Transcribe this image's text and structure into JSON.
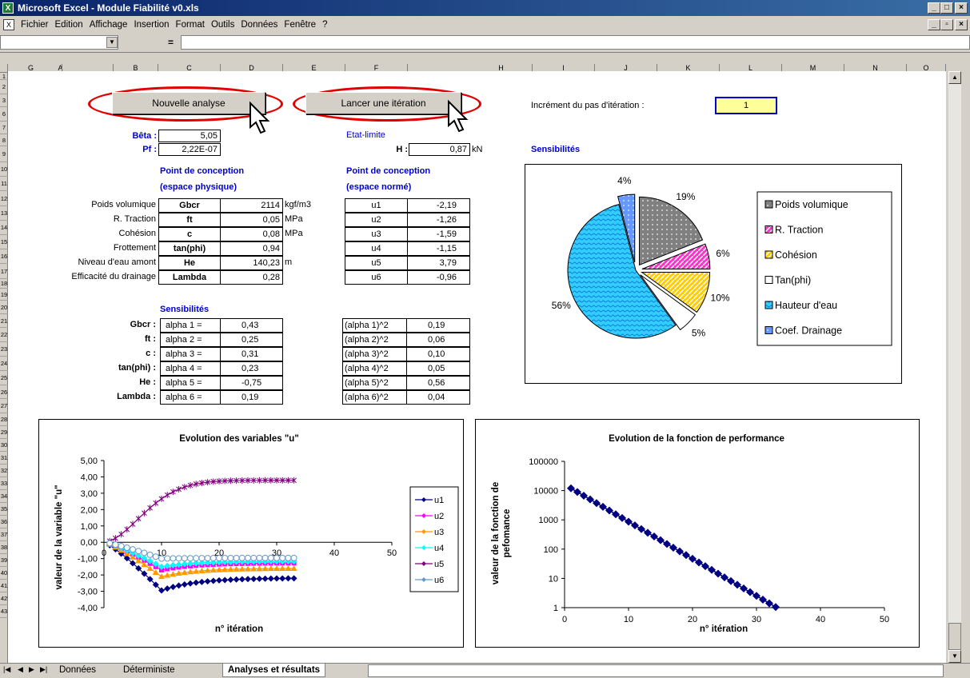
{
  "window": {
    "title": "Microsoft Excel - Module Fiabilité v0.xls",
    "icon": "excel-icon"
  },
  "menu": [
    "Fichier",
    "Edition",
    "Affichage",
    "Insertion",
    "Format",
    "Outils",
    "Données",
    "Fenêtre",
    "?"
  ],
  "formula": {
    "name_box": "",
    "equals": "=",
    "content": ""
  },
  "columns": [
    "A",
    "B",
    "C",
    "D",
    "E",
    "F",
    "G",
    "H",
    "I",
    "J",
    "K",
    "L",
    "M",
    "N",
    "O"
  ],
  "rows": [
    "1",
    "2",
    "3",
    "6",
    "7",
    "8",
    "9",
    "10",
    "11",
    "12",
    "13",
    "14",
    "15",
    "16",
    "17",
    "18",
    "19",
    "20",
    "21",
    "22",
    "23",
    "24",
    "25",
    "26",
    "27",
    "28",
    "29",
    "30",
    "31",
    "32",
    "33",
    "34",
    "35",
    "36",
    "37",
    "38",
    "39",
    "40",
    "41",
    "42",
    "43"
  ],
  "buttons": {
    "new_analysis": "Nouvelle analyse",
    "run_iteration": "Lancer une itération"
  },
  "increment": {
    "label": "Incrément du pas d'itération :",
    "value": "1"
  },
  "beta": {
    "label": "Bêta :",
    "value": "5,05"
  },
  "pf": {
    "label": "Pf :",
    "value": "2,22E-07"
  },
  "limit_state": {
    "label": "Etat-limite",
    "h_label": "H :",
    "h_value": "0,87",
    "h_unit": "kN"
  },
  "sensibilites_title": "Sensibilités",
  "design_point_physical": {
    "title1": "Point de conception",
    "title2": "(espace physique)",
    "rows": [
      {
        "name": "Poids volumique",
        "sym": "Gbcr",
        "value": "2114",
        "unit": "kgf/m3"
      },
      {
        "name": "R. Traction",
        "sym": "ft",
        "value": "0,05",
        "unit": "MPa"
      },
      {
        "name": "Cohésion",
        "sym": "c",
        "value": "0,08",
        "unit": "MPa"
      },
      {
        "name": "Frottement",
        "sym": "tan(phi)",
        "value": "0,94",
        "unit": ""
      },
      {
        "name": "Niveau d'eau amont",
        "sym": "He",
        "value": "140,23",
        "unit": "m"
      },
      {
        "name": "Efficacité du drainage",
        "sym": "Lambda",
        "value": "0,28",
        "unit": ""
      }
    ]
  },
  "design_point_normed": {
    "title1": "Point de conception",
    "title2": "(espace normé)",
    "rows": [
      {
        "sym": "u1",
        "value": "-2,19"
      },
      {
        "sym": "u2",
        "value": "-1,26"
      },
      {
        "sym": "u3",
        "value": "-1,59"
      },
      {
        "sym": "u4",
        "value": "-1,15"
      },
      {
        "sym": "u5",
        "value": "3,79"
      },
      {
        "sym": "u6",
        "value": "-0,96"
      }
    ]
  },
  "sensitivities": {
    "title": "Sensibilités",
    "rows": [
      {
        "var": "Gbcr :",
        "alpha": "alpha 1 =",
        "value": "0,43",
        "sq": "(alpha 1)^2",
        "sqv": "0,19"
      },
      {
        "var": "ft :",
        "alpha": "alpha 2 =",
        "value": "0,25",
        "sq": "(alpha 2)^2",
        "sqv": "0,06"
      },
      {
        "var": "c :",
        "alpha": "alpha 3 =",
        "value": "0,31",
        "sq": "(alpha 3)^2",
        "sqv": "0,10"
      },
      {
        "var": "tan(phi) :",
        "alpha": "alpha 4 =",
        "value": "0,23",
        "sq": "(alpha 4)^2",
        "sqv": "0,05"
      },
      {
        "var": "He :",
        "alpha": "alpha 5 =",
        "value": "-0,75",
        "sq": "(alpha 5)^2",
        "sqv": "0,56"
      },
      {
        "var": "Lambda :",
        "alpha": "alpha 6 =",
        "value": "0,19",
        "sq": "(alpha 6)^2",
        "sqv": "0,04"
      }
    ]
  },
  "chart_data": [
    {
      "type": "pie",
      "title": "",
      "labels": [
        "Poids volumique",
        "R. Traction",
        "Cohésion",
        "Tan(phi)",
        "Hauteur d'eau",
        "Coef. Drainage"
      ],
      "values": [
        19,
        6,
        10,
        5,
        56,
        4
      ],
      "value_labels": [
        "19%",
        "6%",
        "10%",
        "5%",
        "56%",
        "4%"
      ],
      "colors": [
        "#808080",
        "#ff33cc",
        "#ffcc00",
        "#ffffff",
        "#33ccff",
        "#6699ff"
      ],
      "legend": "right"
    },
    {
      "type": "line",
      "title": "Evolution des variables \"u\"",
      "xlabel": "n° itération",
      "ylabel": "valeur de la variable \"u\"",
      "xlim": [
        0,
        50
      ],
      "ylim": [
        -4,
        5
      ],
      "x_ticks": [
        "0",
        "10",
        "20",
        "30",
        "40",
        "50"
      ],
      "y_ticks": [
        "5,00",
        "4,00",
        "3,00",
        "2,00",
        "1,00",
        "0,00",
        "-1,00",
        "-2,00",
        "-3,00",
        "-4,00"
      ],
      "legend": "right",
      "series": [
        {
          "name": "u1",
          "color": "#000080",
          "marker": "diamond",
          "final": -2.19,
          "min": -2.95
        },
        {
          "name": "u2",
          "color": "#ff00ff",
          "marker": "square",
          "final": -1.26,
          "min": -1.7
        },
        {
          "name": "u3",
          "color": "#ff9900",
          "marker": "triangle",
          "final": -1.59,
          "min": -2.1
        },
        {
          "name": "u4",
          "color": "#00ffff",
          "marker": "diamond",
          "final": -1.15,
          "min": -1.5
        },
        {
          "name": "u5",
          "color": "#800080",
          "marker": "star",
          "final": 3.79,
          "min": 0
        },
        {
          "name": "u6",
          "color": "#6699cc",
          "marker": "circle",
          "final": -0.96,
          "min": -1.0
        }
      ],
      "n_iterations": 33
    },
    {
      "type": "line",
      "title": "Evolution de la fonction de performance",
      "xlabel": "n° itération",
      "ylabel": "valeur de la fonction de pefomance",
      "xlim": [
        0,
        50
      ],
      "ylim": [
        1,
        100000
      ],
      "scale": "log",
      "x_ticks": [
        "0",
        "10",
        "20",
        "30",
        "40",
        "50"
      ],
      "y_ticks": [
        "100000",
        "10000",
        "1000",
        "100",
        "10",
        "1"
      ],
      "series": [
        {
          "name": "",
          "color": "#000080",
          "marker": "diamond",
          "start": 12000,
          "end": 1.05,
          "n": 33
        }
      ]
    }
  ],
  "sheet_tabs": [
    "Données",
    "Déterministe",
    "Analyses et résultats"
  ]
}
